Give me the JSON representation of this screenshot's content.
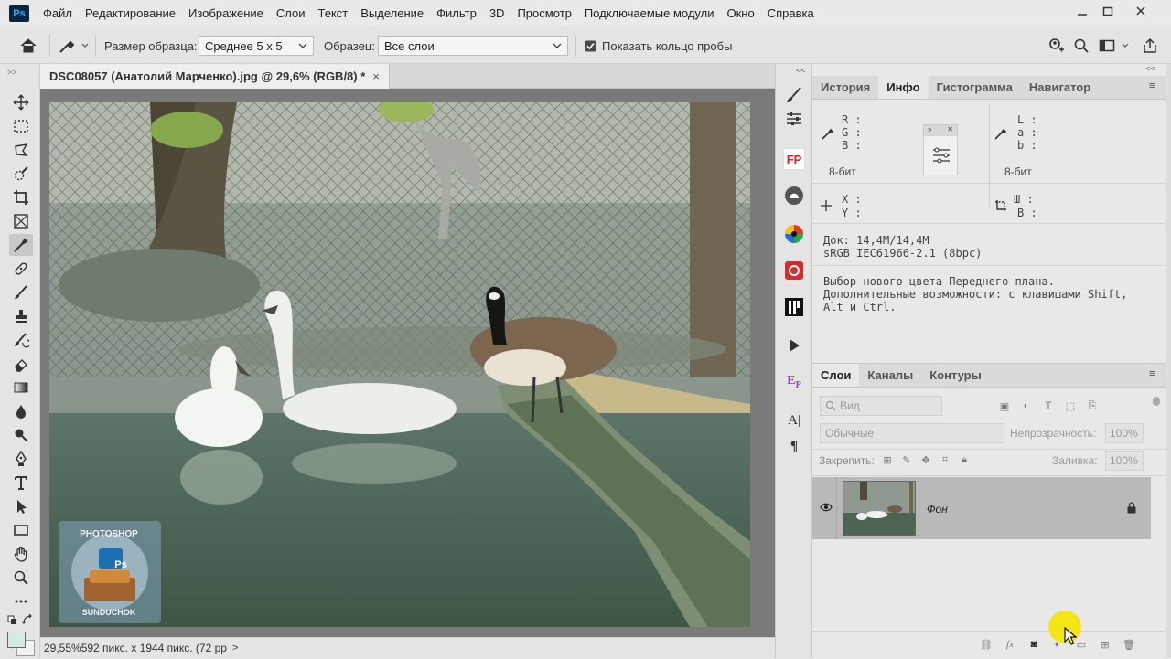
{
  "menubar": {
    "logo": "Ps",
    "items": [
      "Файл",
      "Редактирование",
      "Изображение",
      "Слои",
      "Текст",
      "Выделение",
      "Фильтр",
      "3D",
      "Просмотр",
      "Подключаемые модули",
      "Окно",
      "Справка"
    ]
  },
  "options": {
    "sample_size_label": "Размер образца:",
    "sample_size_value": "Среднее 5 x 5",
    "sample_label": "Образец:",
    "sample_value": "Все слои",
    "show_ring_label": "Показать кольцо пробы",
    "show_ring_checked": true
  },
  "document": {
    "tab_title": "DSC08057 (Анатолий Марченко).jpg @ 29,6% (RGB/8) *",
    "close_symbol": "×",
    "watermark_top": "PHOTOSHOP",
    "watermark_bottom": "SUNDUCHOK",
    "watermark_badge": "Ps"
  },
  "status": {
    "zoom": "29,55%",
    "info": "592 пикс. x 1944 пикс. (72 pp"
  },
  "info_panel": {
    "tabs": [
      "История",
      "Инфо",
      "Гистограмма",
      "Навигатор"
    ],
    "active_tab": "Инфо",
    "rgb_labels": [
      "R :",
      "G :",
      "B :"
    ],
    "lab_labels": [
      "L :",
      "a :",
      "b :"
    ],
    "bit_left": "8-бит",
    "bit_right": "8-бит",
    "xy_labels": [
      "X :",
      "Y :"
    ],
    "wh_labels": [
      "Ш :",
      "В :"
    ],
    "doc_size": "Док: 14,4M/14,4M",
    "color_profile": "sRGB IEC61966-2.1 (8bpc)",
    "hint": "Выбор нового цвета Переднего плана. Дополнительные возможности: с клавишами Shift, Alt и Ctrl."
  },
  "layers_panel": {
    "tabs": [
      "Слои",
      "Каналы",
      "Контуры"
    ],
    "active_tab": "Слои",
    "search_placeholder": "Вид",
    "blend_mode": "Обычные",
    "opacity_label": "Непрозрачность:",
    "opacity_value": "100%",
    "lock_label": "Закрепить:",
    "fill_label": "Заливка:",
    "fill_value": "100%",
    "layers": [
      {
        "name": "Фон",
        "visible": true,
        "locked": true
      }
    ]
  },
  "colors": {
    "accent": "#31a8ff",
    "selected_layer": "#b9b9b9",
    "cursor_highlight": "#f5e400"
  }
}
